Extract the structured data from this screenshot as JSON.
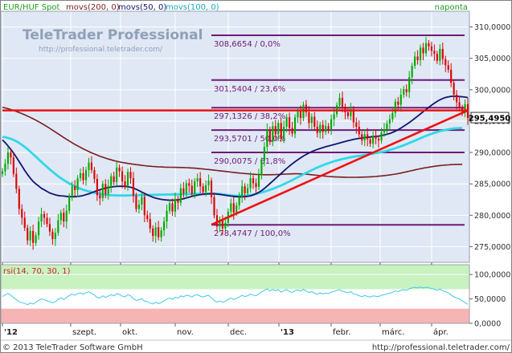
{
  "header": {
    "instrument": "EUR/HUF Spot",
    "indicators": [
      "movs(200, 0)",
      "movs(50, 0)",
      "movs(100, 0)"
    ],
    "period": "naponta"
  },
  "watermark": {
    "brand": "TeleTrader Professional",
    "url": "http://professional.teletrader.com/"
  },
  "footer": {
    "copyright": "© 2013 TeleTrader Software GmbH",
    "url": "http://professional.teletrader.com/"
  },
  "colors": {
    "price_up": "#00aa00",
    "price_down": "#dd0000",
    "ma200": "#7a1e1e",
    "ma50": "#141470",
    "ma100": "#30d8e8",
    "trendline": "#ee1111",
    "fibonacci": "#701878",
    "rsi_line": "#3fc8e8",
    "rsi_upper_zone": "#c8f2c0",
    "rsi_lower_zone": "#f6b4b4"
  },
  "chart_data": [
    {
      "type": "candlestick",
      "title": "EUR/HUF Spot",
      "x_ticks": [
        "'12",
        "szept.",
        "okt.",
        "nov.",
        "dec.",
        "'13",
        "febr.",
        "márc.",
        "ápr."
      ],
      "ylim": [
        272500,
        312500
      ],
      "y_ticks": [
        "310,0000",
        "305,0000",
        "300,0000",
        "295,0000",
        "290,0000",
        "285,0000",
        "280,0000",
        "275,0000"
      ],
      "last_value": 295495,
      "last_value_label": "295,4950",
      "grid": true,
      "series": {
        "close": [
          287000,
          288200,
          290000,
          289200,
          286600,
          284200,
          281000,
          279600,
          278000,
          276000,
          277500,
          275600,
          276800,
          279000,
          280200,
          279600,
          278600,
          277400,
          276200,
          277200,
          279200,
          280400,
          279000,
          280700,
          283000,
          284600,
          284000,
          285900,
          286700,
          285600,
          287200,
          288400,
          287200,
          285800,
          283200,
          282700,
          285000,
          283400,
          284700,
          286200,
          285300,
          287600,
          287000,
          285400,
          284600,
          286900,
          285900,
          283100,
          281000,
          281700,
          282900,
          280000,
          279400,
          277900,
          276700,
          278100,
          276500,
          277600,
          279000,
          280700,
          281900,
          280600,
          282600,
          282000,
          284300,
          283500,
          285100,
          284700,
          283400,
          285400,
          285900,
          284600,
          283700,
          284800,
          285500,
          282900,
          280000,
          278200,
          279300,
          277900,
          278800,
          280600,
          281900,
          280400,
          281600,
          282900,
          284600,
          283500,
          284300,
          285900,
          285100,
          284500,
          286400,
          288700,
          290900,
          293600,
          291700,
          294200,
          292900,
          294700,
          292200,
          294100,
          295600,
          293900,
          293000,
          295600,
          296500,
          295500,
          297600,
          296400,
          294700,
          295700,
          294100,
          293100,
          294400,
          293300,
          294200,
          293700,
          295300,
          296100,
          297500,
          298700,
          297300,
          296400,
          295800,
          296900,
          294800,
          294100,
          292900,
          291900,
          292900,
          292100,
          291400,
          292600,
          292200,
          291900,
          293200,
          293700,
          294600,
          295300,
          296300,
          298100,
          297600,
          299200,
          300100,
          299600,
          302000,
          303800,
          305300,
          304700,
          306700,
          305800,
          307400,
          306900,
          306200,
          305700,
          304600,
          306500,
          304900,
          303900,
          303200,
          301100,
          299200,
          298000,
          297100,
          296500,
          297700,
          295495
        ],
        "ma50": [
          292000,
          291550,
          291050,
          290500,
          289900,
          289250,
          288550,
          287850,
          287150,
          286500,
          285900,
          285400,
          285000,
          284650,
          284300,
          284050,
          283800,
          283550,
          283400,
          283250,
          283150,
          283100,
          283050,
          283000,
          282970,
          282960,
          282950,
          282990,
          283050,
          283150,
          283280,
          283420,
          283580,
          283760,
          283920,
          284060,
          284200,
          284320,
          284420,
          284500,
          284560,
          284600,
          284620,
          284620,
          284600,
          284550,
          284460,
          284320,
          284140,
          283920,
          283700,
          283480,
          283260,
          283060,
          282880,
          282730,
          282620,
          282530,
          282470,
          282430,
          282410,
          282400,
          282420,
          282460,
          282540,
          282640,
          282760,
          282890,
          283010,
          283120,
          283210,
          283280,
          283340,
          283390,
          283420,
          283430,
          283420,
          283380,
          283320,
          283250,
          283180,
          283120,
          283060,
          283000,
          282960,
          282940,
          282940,
          282960,
          283010,
          283100,
          283230,
          283410,
          283640,
          283930,
          284270,
          284650,
          285050,
          285450,
          285850,
          286250,
          286650,
          287050,
          287450,
          287830,
          288190,
          288530,
          288850,
          289150,
          289430,
          289690,
          289920,
          290130,
          290320,
          290490,
          290640,
          290780,
          290910,
          291030,
          291150,
          291270,
          291390,
          291510,
          291630,
          291750,
          291870,
          291980,
          292080,
          292170,
          292250,
          292310,
          292370,
          292420,
          292470,
          292520,
          292570,
          292620,
          292690,
          292780,
          292890,
          293030,
          293200,
          293400,
          293630,
          293890,
          294170,
          294470,
          294780,
          295100,
          295440,
          295790,
          296140,
          296500,
          296850,
          297200,
          297540,
          297860,
          298140,
          298390,
          298600,
          298760,
          298870,
          298940,
          298960,
          298950,
          298920,
          298880,
          298820,
          298750
        ],
        "ma100": [
          292500,
          292420,
          292320,
          292180,
          292000,
          291780,
          291520,
          291220,
          290890,
          290530,
          290140,
          289740,
          289330,
          288910,
          288500,
          288090,
          287690,
          287300,
          286930,
          286570,
          286230,
          285910,
          285610,
          285330,
          285070,
          284830,
          284610,
          284410,
          284230,
          284070,
          283930,
          283800,
          283690,
          283590,
          283500,
          283420,
          283350,
          283290,
          283240,
          283200,
          283170,
          283150,
          283140,
          283140,
          283150,
          283160,
          283170,
          283180,
          283190,
          283200,
          283210,
          283220,
          283230,
          283240,
          283250,
          283260,
          283270,
          283280,
          283290,
          283300,
          283310,
          283320,
          283330,
          283340,
          283350,
          283360,
          283370,
          283380,
          283390,
          283400,
          283410,
          283420,
          283430,
          283440,
          283450,
          283450,
          283440,
          283420,
          283380,
          283330,
          283270,
          283210,
          283160,
          283120,
          283100,
          283090,
          283100,
          283120,
          283160,
          283220,
          283300,
          283400,
          283510,
          283630,
          283760,
          283900,
          284050,
          284210,
          284380,
          284560,
          284750,
          284950,
          285160,
          285380,
          285600,
          285830,
          286060,
          286290,
          286520,
          286750,
          286970,
          287190,
          287400,
          287600,
          287790,
          287970,
          288140,
          288300,
          288450,
          288590,
          288720,
          288840,
          288950,
          289050,
          289150,
          289240,
          289320,
          289400,
          289470,
          289540,
          289610,
          289680,
          289750,
          289820,
          289900,
          289980,
          290070,
          290170,
          290280,
          290400,
          290530,
          290670,
          290820,
          290980,
          291150,
          291330,
          291510,
          291700,
          291890,
          292080,
          292270,
          292460,
          292640,
          292810,
          292970,
          293120,
          293260,
          293390,
          293500,
          293600,
          293690,
          293760,
          293820,
          293860,
          293890,
          293900
        ],
        "ma200": [
          297200,
          297100,
          296980,
          296850,
          296700,
          296540,
          296370,
          296190,
          296000,
          295800,
          295590,
          295370,
          295140,
          294900,
          294650,
          294390,
          294120,
          293840,
          293550,
          293260,
          292970,
          292680,
          292390,
          292110,
          291830,
          291560,
          291300,
          291050,
          290810,
          290580,
          290360,
          290150,
          289950,
          289760,
          289580,
          289410,
          289250,
          289100,
          288960,
          288830,
          288710,
          288600,
          288500,
          288410,
          288330,
          288260,
          288190,
          288130,
          288070,
          288010,
          287950,
          287900,
          287850,
          287810,
          287770,
          287740,
          287710,
          287690,
          287670,
          287660,
          287650,
          287640,
          287630,
          287620,
          287610,
          287600,
          287580,
          287560,
          287530,
          287500,
          287460,
          287420,
          287380,
          287330,
          287280,
          287230,
          287180,
          287130,
          287080,
          287030,
          286980,
          286930,
          286880,
          286830,
          286780,
          286730,
          286690,
          286650,
          286610,
          286570,
          286540,
          286510,
          286490,
          286470,
          286460,
          286460,
          286460,
          286470,
          286480,
          286500,
          286520,
          286540,
          286560,
          286580,
          286600,
          286610,
          286610,
          286600,
          286580,
          286550,
          286510,
          286460,
          286410,
          286360,
          286310,
          286260,
          286220,
          286180,
          286150,
          286120,
          286100,
          286080,
          286070,
          286060,
          286050,
          286050,
          286050,
          286050,
          286060,
          286070,
          286080,
          286100,
          286120,
          286150,
          286180,
          286220,
          286260,
          286310,
          286360,
          286420,
          286490,
          286560,
          286640,
          286730,
          286820,
          286920,
          287020,
          287120,
          287220,
          287320,
          287410,
          287500,
          287580,
          287660,
          287730,
          287800,
          287860,
          287910,
          287960,
          288000,
          288030,
          288060,
          288080,
          288100,
          288110,
          288120
        ]
      },
      "fibonacci": [
        {
          "label": "308,6654 / 0,0%",
          "value": 308665
        },
        {
          "label": "301,5404 / 23,6%",
          "value": 301540
        },
        {
          "label": "297,1326 / 38,2%",
          "value": 297133
        },
        {
          "label": "293,5701 / 50,0%",
          "value": 293570
        },
        {
          "label": "290,0075 / 61,8%",
          "value": 290008
        },
        {
          "label": "278,4747 / 100,0%",
          "value": 278475
        }
      ],
      "trendlines": [
        {
          "x": [
            0,
            167
          ],
          "y": [
            296700,
            296700
          ]
        },
        {
          "x": [
            75,
            167
          ],
          "y": [
            278500,
            296700
          ]
        }
      ]
    },
    {
      "type": "line",
      "title": "rsi(14, 70, 30, 1)",
      "ylim": [
        0,
        120
      ],
      "y_ticks": [
        "100,0000",
        "50,0000",
        "0,0000"
      ],
      "zones": {
        "upper": [
          70,
          120
        ],
        "lower": [
          0,
          30
        ]
      },
      "values": [
        55.2,
        58.1,
        61.3,
        57.8,
        52.4,
        48.6,
        44.1,
        42.3,
        40.8,
        38.2,
        41.6,
        39.4,
        42.8,
        47.3,
        50.2,
        48.1,
        46.2,
        44.3,
        42.1,
        44.6,
        49.1,
        52.2,
        48.7,
        52.6,
        57.1,
        59.6,
        57.9,
        61.2,
        62.4,
        59.7,
        62.8,
        64.6,
        61.4,
        57.8,
        52.6,
        51.7,
        56.4,
        53.1,
        55.8,
        58.6,
        56.4,
        60.7,
        59.1,
        55.6,
        54.1,
        58.8,
        56.2,
        50.6,
        46.8,
        48.2,
        50.7,
        45.3,
        44.2,
        41.6,
        39.8,
        43.1,
        40.2,
        42.7,
        45.9,
        49.4,
        51.8,
        49.1,
        53.1,
        51.7,
        56.3,
        54.4,
        57.6,
        56.6,
        53.8,
        57.7,
        58.6,
        55.8,
        53.9,
        56.1,
        57.6,
        52.1,
        46.6,
        43.4,
        45.8,
        43.1,
        45.1,
        48.9,
        51.6,
        48.5,
        51.1,
        53.8,
        57.3,
        54.9,
        56.6,
        59.7,
        57.9,
        56.6,
        60.3,
        64.2,
        67.5,
        70.6,
        66.2,
        69.4,
        66.8,
        68.9,
        63.7,
        66.9,
        68.8,
        65.1,
        63.2,
        67.1,
        68.3,
        66.1,
        69.6,
        66.8,
        62.9,
        64.8,
        61.6,
        59.7,
        62.3,
        60.1,
        61.9,
        60.8,
        63.9,
        65.2,
        67.4,
        68.9,
        65.8,
        63.9,
        62.6,
        64.7,
        60.4,
        58.9,
        56.6,
        54.7,
        56.8,
        55.2,
        53.9,
        56.3,
        55.5,
        54.9,
        57.6,
        58.6,
        60.4,
        61.8,
        63.6,
        66.4,
        65.1,
        67.6,
        68.9,
        67.6,
        70.8,
        72.6,
        73.9,
        72.3,
        74.4,
        72.4,
        74.1,
        72.9,
        71.3,
        70.1,
        67.6,
        70.3,
        66.8,
        64.2,
        62.6,
        58.1,
        54.3,
        51.9,
        49.8,
        46.2,
        42.8,
        38.8
      ]
    }
  ]
}
